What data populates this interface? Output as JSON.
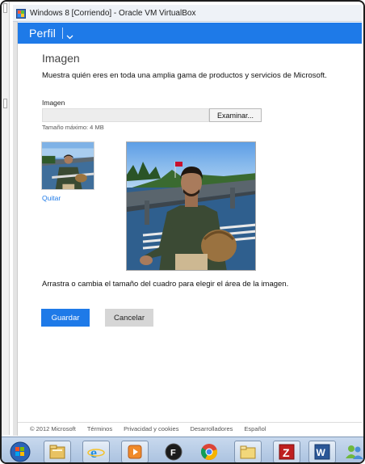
{
  "window": {
    "title": "Windows 8 [Corriendo] - Oracle VM VirtualBox"
  },
  "appbar": {
    "title": "Perfil"
  },
  "page": {
    "heading": "Imagen",
    "subtitle": "Muestra quién eres en toda una amplia gama de productos y servicios de Microsoft.",
    "image_field_label": "Imagen",
    "file_input_value": "",
    "browse_label": "Examinar...",
    "max_size_note": "Tamaño máximo: 4 MB",
    "remove_label": "Quitar",
    "instruction": "Arrastra o cambia el tamaño del cuadro para elegir el área de la imagen.",
    "save_label": "Guardar",
    "cancel_label": "Cancelar"
  },
  "footer": {
    "copyright": "© 2012 Microsoft",
    "links": [
      "Términos",
      "Privacidad y cookies",
      "Desarrolladores",
      "Español"
    ]
  },
  "taskbar": {
    "items": [
      {
        "name": "start-orb-icon"
      },
      {
        "name": "file-explorer-icon"
      },
      {
        "name": "internet-explorer-icon"
      },
      {
        "name": "media-player-icon"
      },
      {
        "name": "f-app-icon"
      },
      {
        "name": "chrome-icon"
      },
      {
        "name": "folder-icon"
      },
      {
        "name": "filezilla-icon"
      },
      {
        "name": "word-icon"
      },
      {
        "name": "people-icon"
      }
    ]
  },
  "colors": {
    "accent": "#1e7ae8",
    "cancel_bg": "#d6d6d6"
  }
}
